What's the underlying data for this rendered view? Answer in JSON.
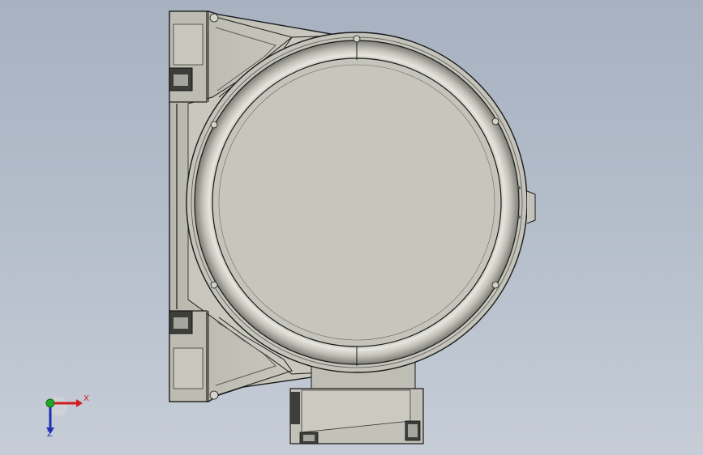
{
  "viewport": {
    "background_top": "#a7b1c0",
    "background_bottom": "#c6cdd7"
  },
  "model": {
    "description_icon": "motor-housing-model",
    "body_color": "#c5c4bb",
    "shadow_color": "#8f8f86",
    "edge_color": "#1a1a1a"
  },
  "triad": {
    "x_label": "X",
    "z_label": "Z",
    "x_color": "#d11f1f",
    "y_color": "#1fa82a",
    "z_color": "#1f2fb6"
  }
}
